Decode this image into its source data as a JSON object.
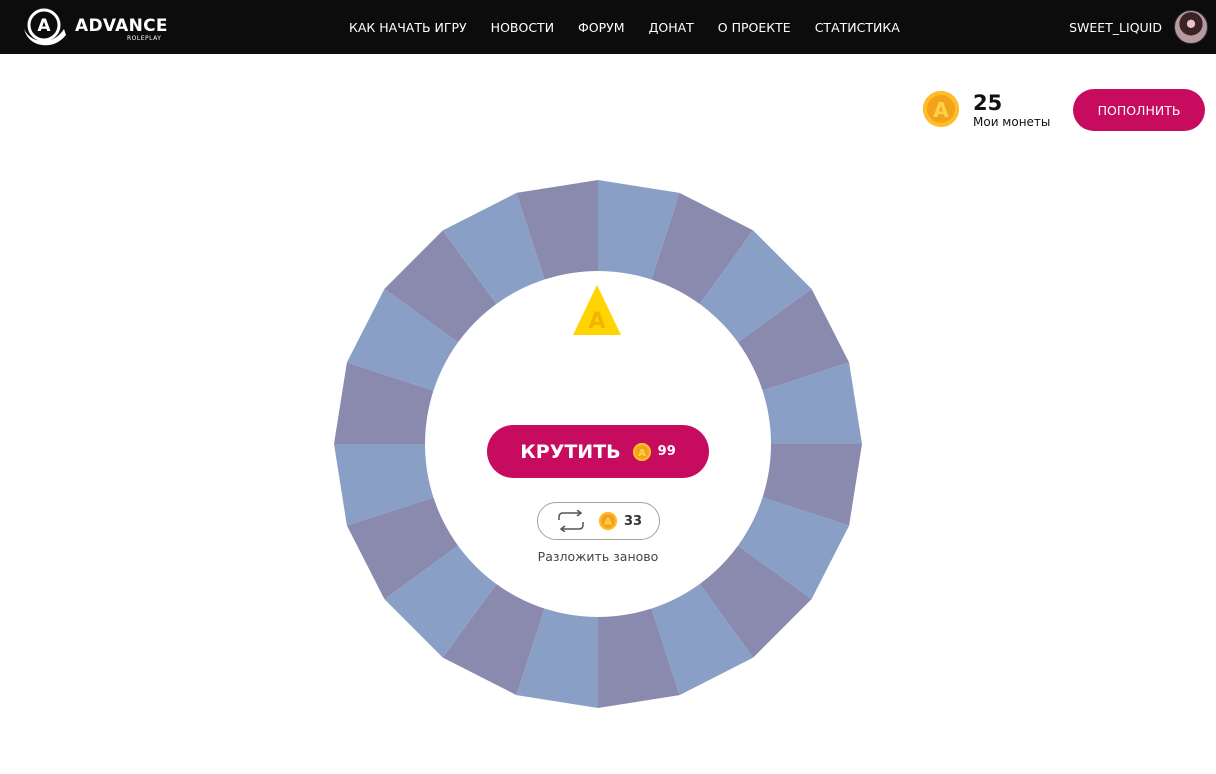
{
  "header": {
    "logo": {
      "title": "ADVANCE",
      "subtitle": "ROLEPLAY",
      "icon": "advance-logo-icon"
    },
    "nav": [
      {
        "label": "КАК НАЧАТЬ ИГРУ"
      },
      {
        "label": "НОВОСТИ"
      },
      {
        "label": "ФОРУМ"
      },
      {
        "label": "ДОНАТ"
      },
      {
        "label": "О ПРОЕКТЕ"
      },
      {
        "label": "СТАТИСТИКА"
      }
    ],
    "user": {
      "name": "SWEET_LIQUID",
      "avatar_icon": "user-avatar"
    }
  },
  "balance": {
    "amount": "25",
    "label": "Мои монеты",
    "topup_label": "ПОПОЛНИТЬ",
    "coin_icon": "coin-icon"
  },
  "wheel": {
    "segments": 20,
    "colors": [
      "#8a9fc6",
      "#8a8aae"
    ],
    "pointer_icon": "pointer-triangle-icon"
  },
  "spin": {
    "label": "КРУТИТЬ",
    "price": "99"
  },
  "reshuffle": {
    "price": "33",
    "label": "Разложить заново",
    "icon": "refresh-icon"
  },
  "colors": {
    "accent": "#c70b5f",
    "topbar": "#0c0c0c",
    "coin": "#f3a31b",
    "pointer": "#ffd400"
  }
}
